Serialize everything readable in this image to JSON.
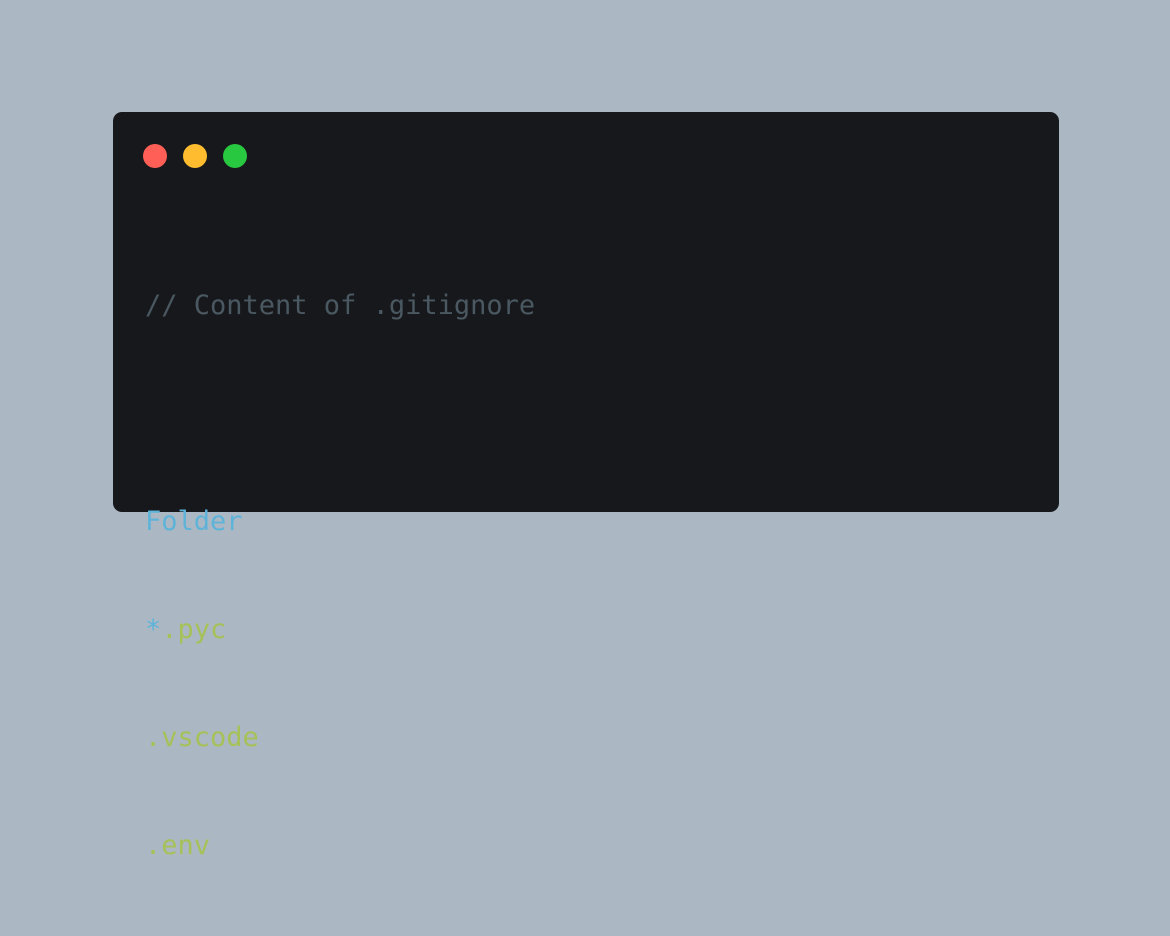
{
  "colors": {
    "background": "#abb8c3",
    "window": "#17181b",
    "close": "#ff5f57",
    "minimize": "#febc2e",
    "maximize": "#28c840",
    "comment": "#4a5861",
    "keyword_blue": "#5fb3d9",
    "string_green": "#a6c157"
  },
  "window_controls": {
    "close": {
      "icon": "close-dot-icon"
    },
    "minimize": {
      "icon": "minimize-dot-icon"
    },
    "maximize": {
      "icon": "maximize-dot-icon"
    }
  },
  "code": {
    "comment": "// Content of .gitignore",
    "lines": [
      {
        "parts": [
          {
            "text": "Folder",
            "color": "keyword_blue"
          }
        ]
      },
      {
        "parts": [
          {
            "text": "*",
            "color": "keyword_blue"
          },
          {
            "text": ".pyc",
            "color": "string_green"
          }
        ]
      },
      {
        "parts": [
          {
            "text": ".vscode",
            "color": "string_green"
          }
        ]
      },
      {
        "parts": [
          {
            "text": ".env",
            "color": "string_green"
          }
        ]
      }
    ]
  }
}
